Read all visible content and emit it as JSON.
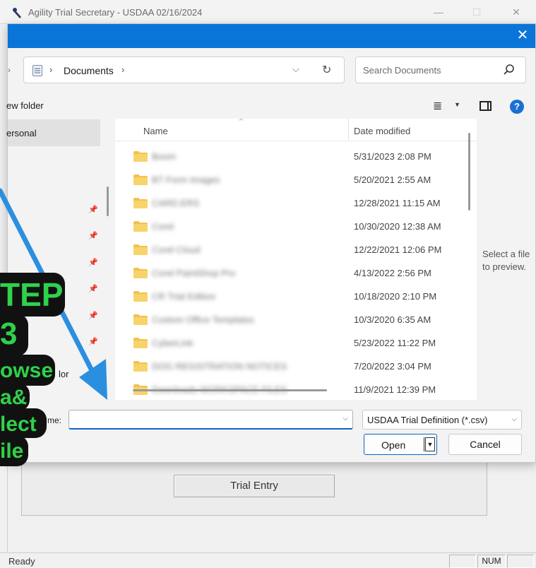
{
  "app": {
    "title": "Agility Trial Secretary - USDAA 02/16/2024",
    "minimize": "—",
    "maximize": "☐",
    "close": "✕",
    "trial_entry_button": "Trial Entry",
    "status_ready": "Ready",
    "status_num": "NUM"
  },
  "dialog": {
    "close": "✕",
    "address": {
      "separator": "›",
      "path": "Documents",
      "dropdown": "⌵",
      "refresh": "↻"
    },
    "search": {
      "placeholder": "Search Documents"
    },
    "back_chevron": "›",
    "new_folder": "ew folder",
    "view_menu": "≣",
    "view_dropdown": "▼",
    "help": "?",
    "nav": {
      "personal": "ersonal",
      "color_label": "lor",
      "pin": "📌"
    },
    "columns": {
      "name": "Name",
      "date_modified": "Date modified",
      "sort_indicator": "^"
    },
    "files": [
      {
        "name": "Boom",
        "date": "5/31/2023 2:08 PM"
      },
      {
        "name": "BT Form Images",
        "date": "5/20/2021 2:55 AM"
      },
      {
        "name": "CARD.ERS",
        "date": "12/28/2021 11:15 AM"
      },
      {
        "name": "Corel",
        "date": "10/30/2020 12:38 AM"
      },
      {
        "name": "Corel Cloud",
        "date": "12/22/2021 12:06 PM"
      },
      {
        "name": "Corel PaintShop Pro",
        "date": "4/13/2022 2:56 PM"
      },
      {
        "name": "CR Trial Edition",
        "date": "10/18/2020 2:10 PM"
      },
      {
        "name": "Custom Office Templates",
        "date": "10/3/2020 6:35 AM"
      },
      {
        "name": "CyberLink",
        "date": "5/23/2022 11:22 PM"
      },
      {
        "name": "DOG REGISTRATION NOTICES",
        "date": "7/20/2022 3:04 PM"
      },
      {
        "name": "Downloads WORKSPACE FILES",
        "date": "11/9/2021 12:39 PM"
      }
    ],
    "preview_text": "Select a file to preview.",
    "filename_label": "me:",
    "filename_value": "",
    "filename_dropdown": "⌵",
    "file_type": "USDAA Trial Definition (*.csv)",
    "file_type_dropdown": "⌵",
    "open_button": "Open",
    "open_arrow": "▼",
    "cancel_button": "Cancel"
  },
  "overlay": {
    "lines": [
      "TEP",
      "3",
      "owse",
      "a&",
      "lect",
      "ile"
    ],
    "text_color": "#2fd14a",
    "arrow_color": "#2b8fe0"
  }
}
